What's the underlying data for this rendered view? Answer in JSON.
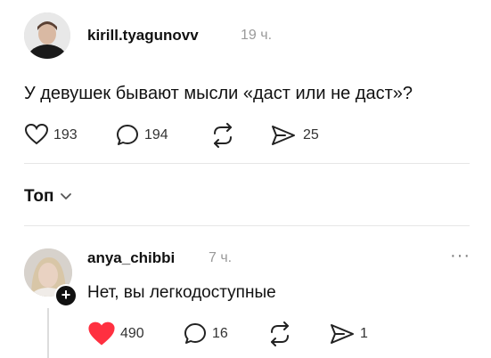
{
  "post": {
    "author": "kirill.tyagunovv",
    "time": "19 ч.",
    "text": "У девушек бывают мысли «даст или не даст»?",
    "likes": "193",
    "comments": "194",
    "shares": "25"
  },
  "sort": {
    "label": "Топ"
  },
  "reply": {
    "author": "anya_chibbi",
    "time": "7 ч.",
    "text": "Нет, вы легкодоступные",
    "likes": "490",
    "comments": "16",
    "shares": "1",
    "more": "···",
    "follow_badge": "+"
  },
  "colors": {
    "like_active": "#ff3040",
    "muted": "#9a9a9a",
    "divider": "#e6e6e6"
  },
  "icons": [
    "heart-icon",
    "comment-icon",
    "repost-icon",
    "share-icon",
    "chevron-down-icon",
    "more-icon",
    "plus-icon"
  ]
}
